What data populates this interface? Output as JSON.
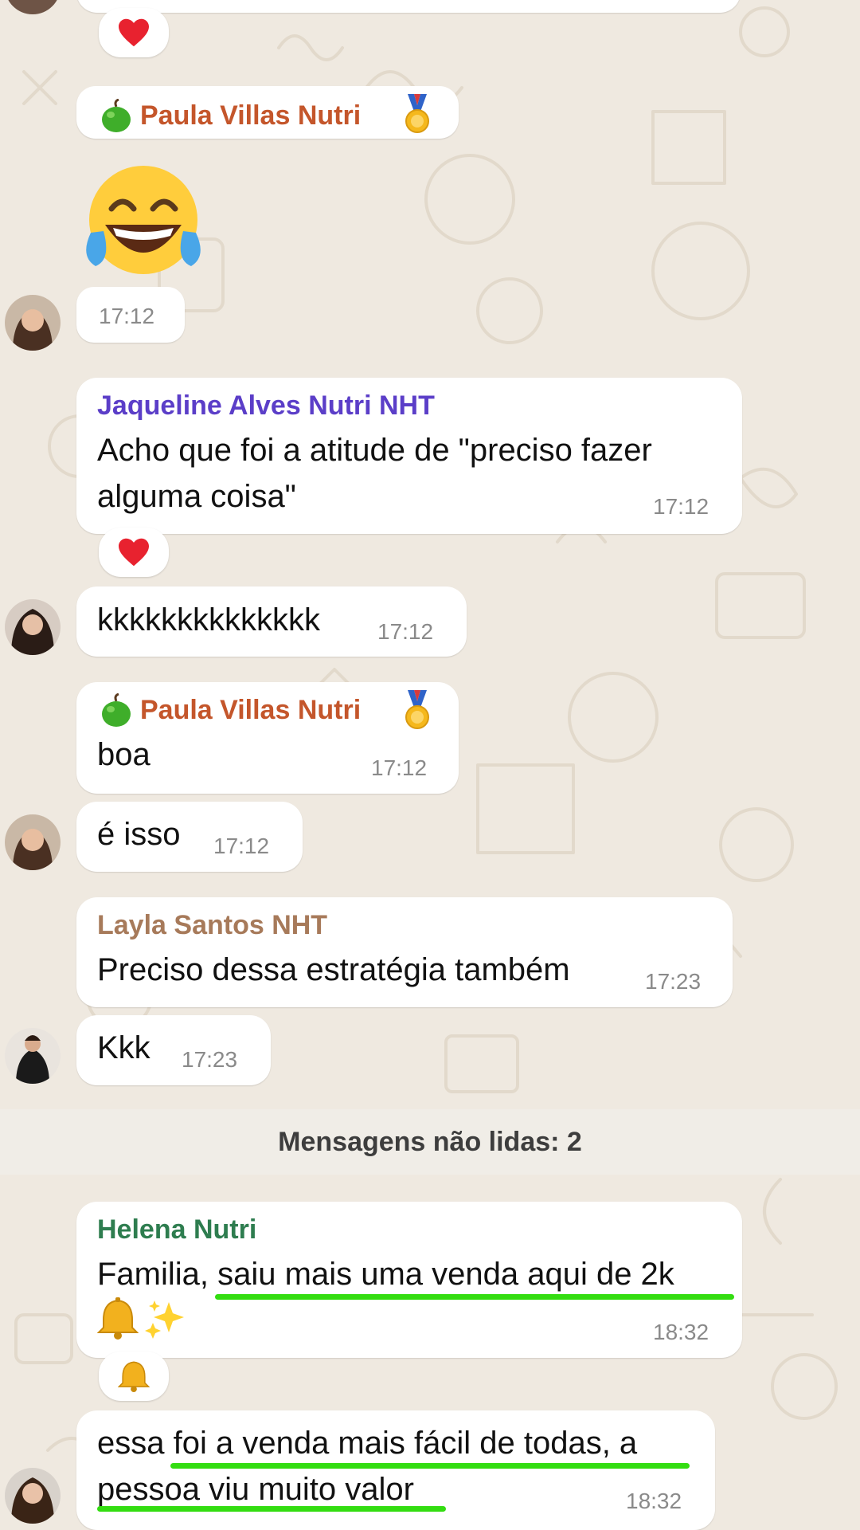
{
  "messages": {
    "m1": {
      "sender": "Paula Villas Nutri",
      "time": "17:12"
    },
    "m2": {
      "sender": "Jaqueline Alves Nutri NHT",
      "line1": "Acho que foi a atitude de \"preciso fazer",
      "line2": "alguma coisa\"",
      "time": "17:12"
    },
    "m3": {
      "text": "kkkkkkkkkkkkkk",
      "time": "17:12"
    },
    "m4": {
      "sender": "Paula Villas Nutri",
      "text": "boa",
      "time": "17:12"
    },
    "m5": {
      "text": "é isso",
      "time": "17:12"
    },
    "m6": {
      "sender": "Layla Santos NHT",
      "text": "Preciso dessa estratégia também",
      "time": "17:23"
    },
    "m7": {
      "text": "Kkk",
      "time": "17:23"
    },
    "m8": {
      "sender": "Helena Nutri",
      "line1": "Familia, saiu mais uma venda aqui de 2k",
      "time": "18:32"
    },
    "m9": {
      "line1": "essa foi a venda mais fácil de todas, a",
      "line2": "pessoa viu muito valor",
      "time": "18:32"
    }
  },
  "unread_label": "Mensagens não lidas: 2",
  "colors": {
    "paula": "#c4562b",
    "jaqueline": "#5b3ec8",
    "layla": "#a77a5a",
    "helena": "#2e7d4f",
    "highlight": "#33dd11",
    "bubble": "#ffffff",
    "wallpaper": "#efe9e0"
  },
  "icons": [
    "heart-reaction-icon",
    "apple-icon",
    "medal-icon",
    "laughing-tears-emoji",
    "bell-emoji",
    "sparkles-emoji",
    "bell-reaction-icon"
  ]
}
